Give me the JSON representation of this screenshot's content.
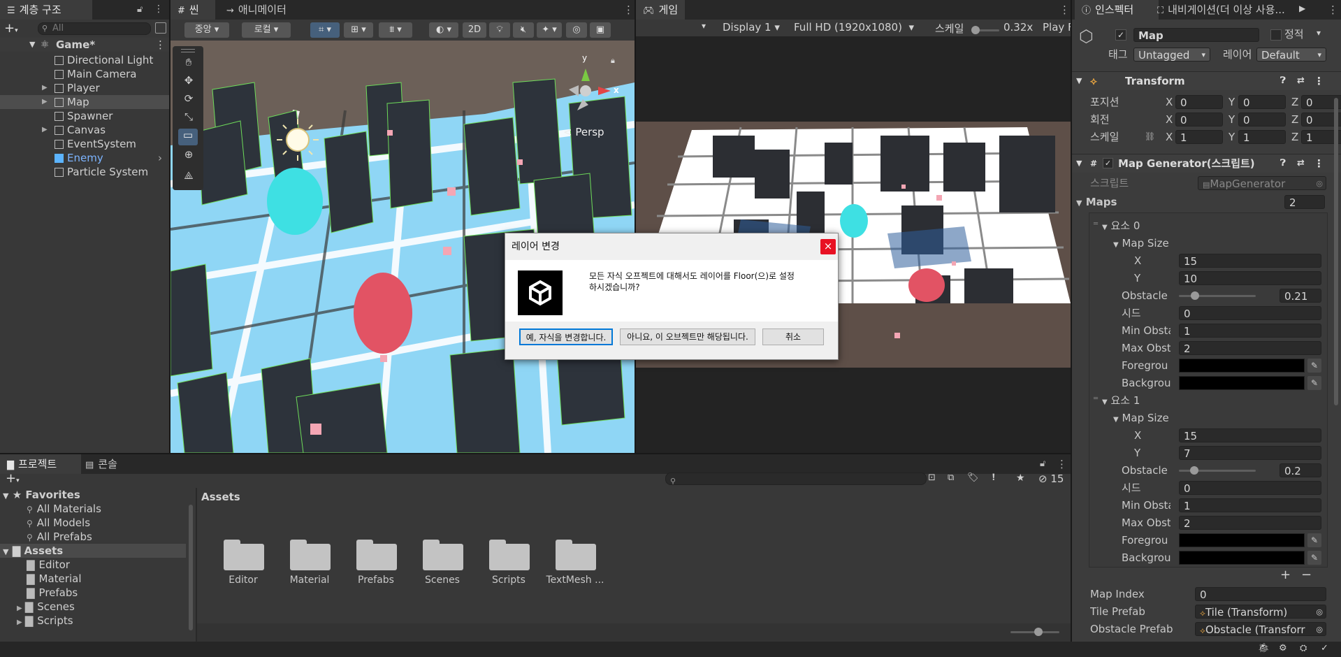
{
  "hierarchy": {
    "tab_label": "계층 구조",
    "search_placeholder": "All",
    "scene_name": "Game*",
    "items": [
      {
        "label": "Directional Light",
        "expandable": false
      },
      {
        "label": "Main Camera",
        "expandable": false
      },
      {
        "label": "Player",
        "expandable": true
      },
      {
        "label": "Map",
        "expandable": true,
        "selected": true
      },
      {
        "label": "Spawner",
        "expandable": false
      },
      {
        "label": "Canvas",
        "expandable": true
      },
      {
        "label": "EventSystem",
        "expandable": false
      },
      {
        "label": "Enemy",
        "expandable": false,
        "prefab": true
      },
      {
        "label": "Particle System",
        "expandable": false
      }
    ]
  },
  "scene_view": {
    "tabs": [
      "씬",
      "애니메이터"
    ],
    "pivot_label": "중앙",
    "space_label": "로컬",
    "mode_2d": "2D",
    "persp_label": "< Persp",
    "gizmo_axes": [
      "y",
      "x"
    ]
  },
  "game_view": {
    "tab_label": "게임",
    "display": "Display 1",
    "resolution": "Full HD (1920x1080)",
    "scale_label": "스케일",
    "scale_value": "0.32x",
    "play_label": "Play F"
  },
  "inspector": {
    "tabs": [
      "인스펙터",
      "내비게이션(더 이상 사용..."
    ],
    "object_name": "Map",
    "static_label": "정적",
    "tag_label": "태그",
    "tag_value": "Untagged",
    "layer_label": "레이어",
    "layer_value": "Default",
    "transform": {
      "title": "Transform",
      "rows": [
        {
          "label": "포지션",
          "x": "0",
          "y": "0",
          "z": "0"
        },
        {
          "label": "회전",
          "x": "0",
          "y": "0",
          "z": "0"
        },
        {
          "label": "스케일",
          "x": "1",
          "y": "1",
          "z": "1"
        }
      ]
    },
    "map_generator": {
      "title": "Map Generator(스크립트)",
      "script_label": "스크립트",
      "script_value": "MapGenerator",
      "maps_label": "Maps",
      "maps_count": "2",
      "elements": [
        {
          "label": "요소 0",
          "map_size_label": "Map Size",
          "x": "15",
          "y": "10",
          "obstacle_label": "Obstacle",
          "obstacle": 0.21,
          "obstacle_text": "0.21",
          "seed_label": "시드",
          "seed": "0",
          "min_label": "Min Obsta",
          "min": "1",
          "max_label": "Max Obst",
          "max": "2",
          "fg_label": "Foregrou",
          "bg_label": "Backgrou"
        },
        {
          "label": "요소 1",
          "map_size_label": "Map Size",
          "x": "15",
          "y": "7",
          "obstacle_label": "Obstacle",
          "obstacle": 0.2,
          "obstacle_text": "0.2",
          "seed_label": "시드",
          "seed": "0",
          "min_label": "Min Obsta",
          "min": "1",
          "max_label": "Max Obst",
          "max": "2",
          "fg_label": "Foregrou",
          "bg_label": "Backgrou"
        }
      ],
      "map_index_label": "Map Index",
      "map_index": "0",
      "tile_prefab_label": "Tile Prefab",
      "tile_prefab": "Tile (Transform)",
      "obstacle_prefab_label": "Obstacle Prefab",
      "obstacle_prefab": "Obstacle (Transforr"
    }
  },
  "project": {
    "tabs": [
      "프로젝트",
      "콘솔"
    ],
    "hidden_count": "15",
    "favorites_label": "Favorites",
    "favorites": [
      "All Materials",
      "All Models",
      "All Prefabs"
    ],
    "assets_label": "Assets",
    "asset_tree": [
      "Editor",
      "Material",
      "Prefabs",
      "Scenes",
      "Scripts"
    ],
    "breadcrumb": "Assets",
    "folders": [
      "Editor",
      "Material",
      "Prefabs",
      "Scenes",
      "Scripts",
      "TextMesh ..."
    ]
  },
  "dialog": {
    "title": "레이어 변경",
    "message_line1": "모든 자식 오프젝트에 대해서도 레이어를 Floor(으)로 설정",
    "message_line2": "하시겠습니까?",
    "btn_yes": "예, 자식을 변경합니다.",
    "btn_no": "아니요, 이 오브젝트만 해당됩니다.",
    "btn_cancel": "취소",
    "close_glyph": "×"
  },
  "colors": {
    "accent": "#46607c",
    "enemy_text": "#7cb4ff",
    "floor_blue": "#8fd6f5",
    "dialog_close": "#e81123"
  }
}
